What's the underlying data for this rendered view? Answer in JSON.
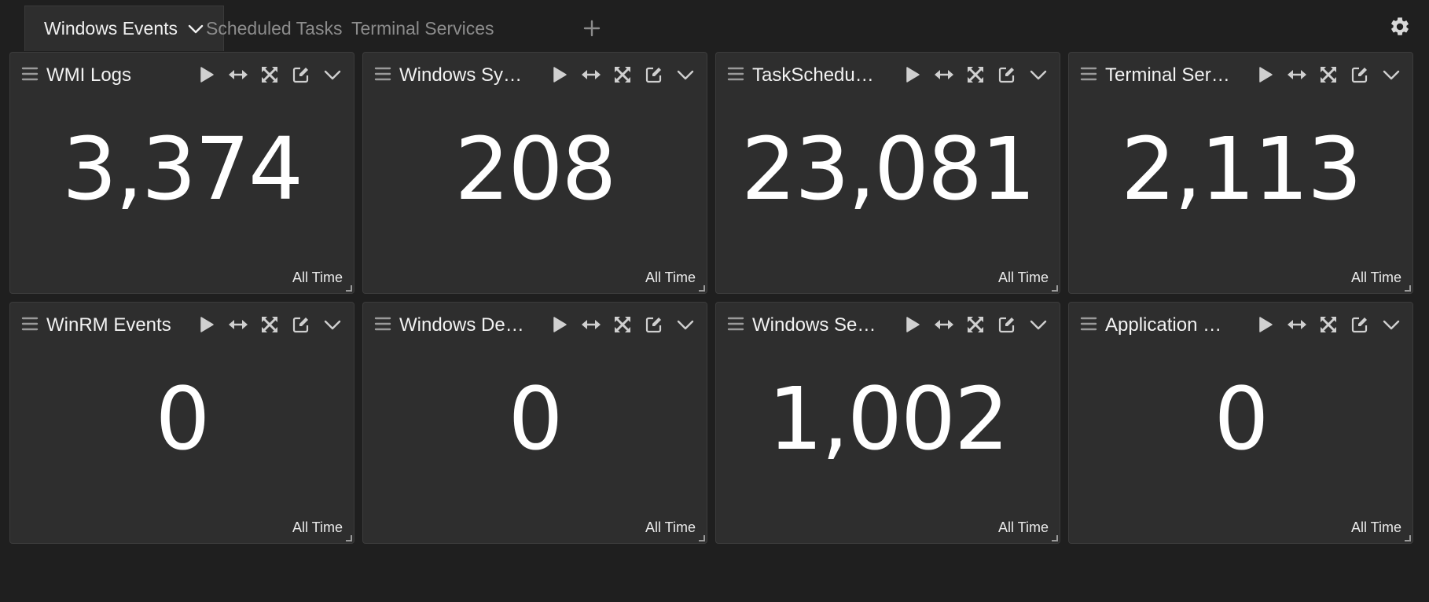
{
  "tabs": [
    {
      "label": "Windows Events",
      "active": true
    },
    {
      "label": "Scheduled Tasks",
      "active": false
    },
    {
      "label": "Terminal Services",
      "active": false
    }
  ],
  "add_tab_icon": "plus-icon",
  "settings_icon": "gear-icon",
  "widgets": [
    {
      "title": "WMI Logs",
      "value": "3,374",
      "range": "All Time"
    },
    {
      "title": "Windows Syst…",
      "value": "208",
      "range": "All Time"
    },
    {
      "title": "TaskSchedule…",
      "value": "23,081",
      "range": "All Time"
    },
    {
      "title": "Terminal Servi…",
      "value": "2,113",
      "range": "All Time"
    },
    {
      "title": "WinRM Events",
      "value": "0",
      "range": "All Time"
    },
    {
      "title": "Windows Defe…",
      "value": "0",
      "range": "All Time"
    },
    {
      "title": "Windows Secu…",
      "value": "1,002",
      "range": "All Time"
    },
    {
      "title": "Application Lo…",
      "value": "0",
      "range": "All Time"
    }
  ],
  "widget_actions": [
    "play-icon",
    "expand-horizontal-icon",
    "maximize-icon",
    "edit-icon",
    "chevron-down-icon"
  ],
  "colors": {
    "background": "#1f1f1f",
    "panel": "#2e2e2e",
    "text": "#ffffff",
    "muted_tab": "#8c8c8c"
  }
}
